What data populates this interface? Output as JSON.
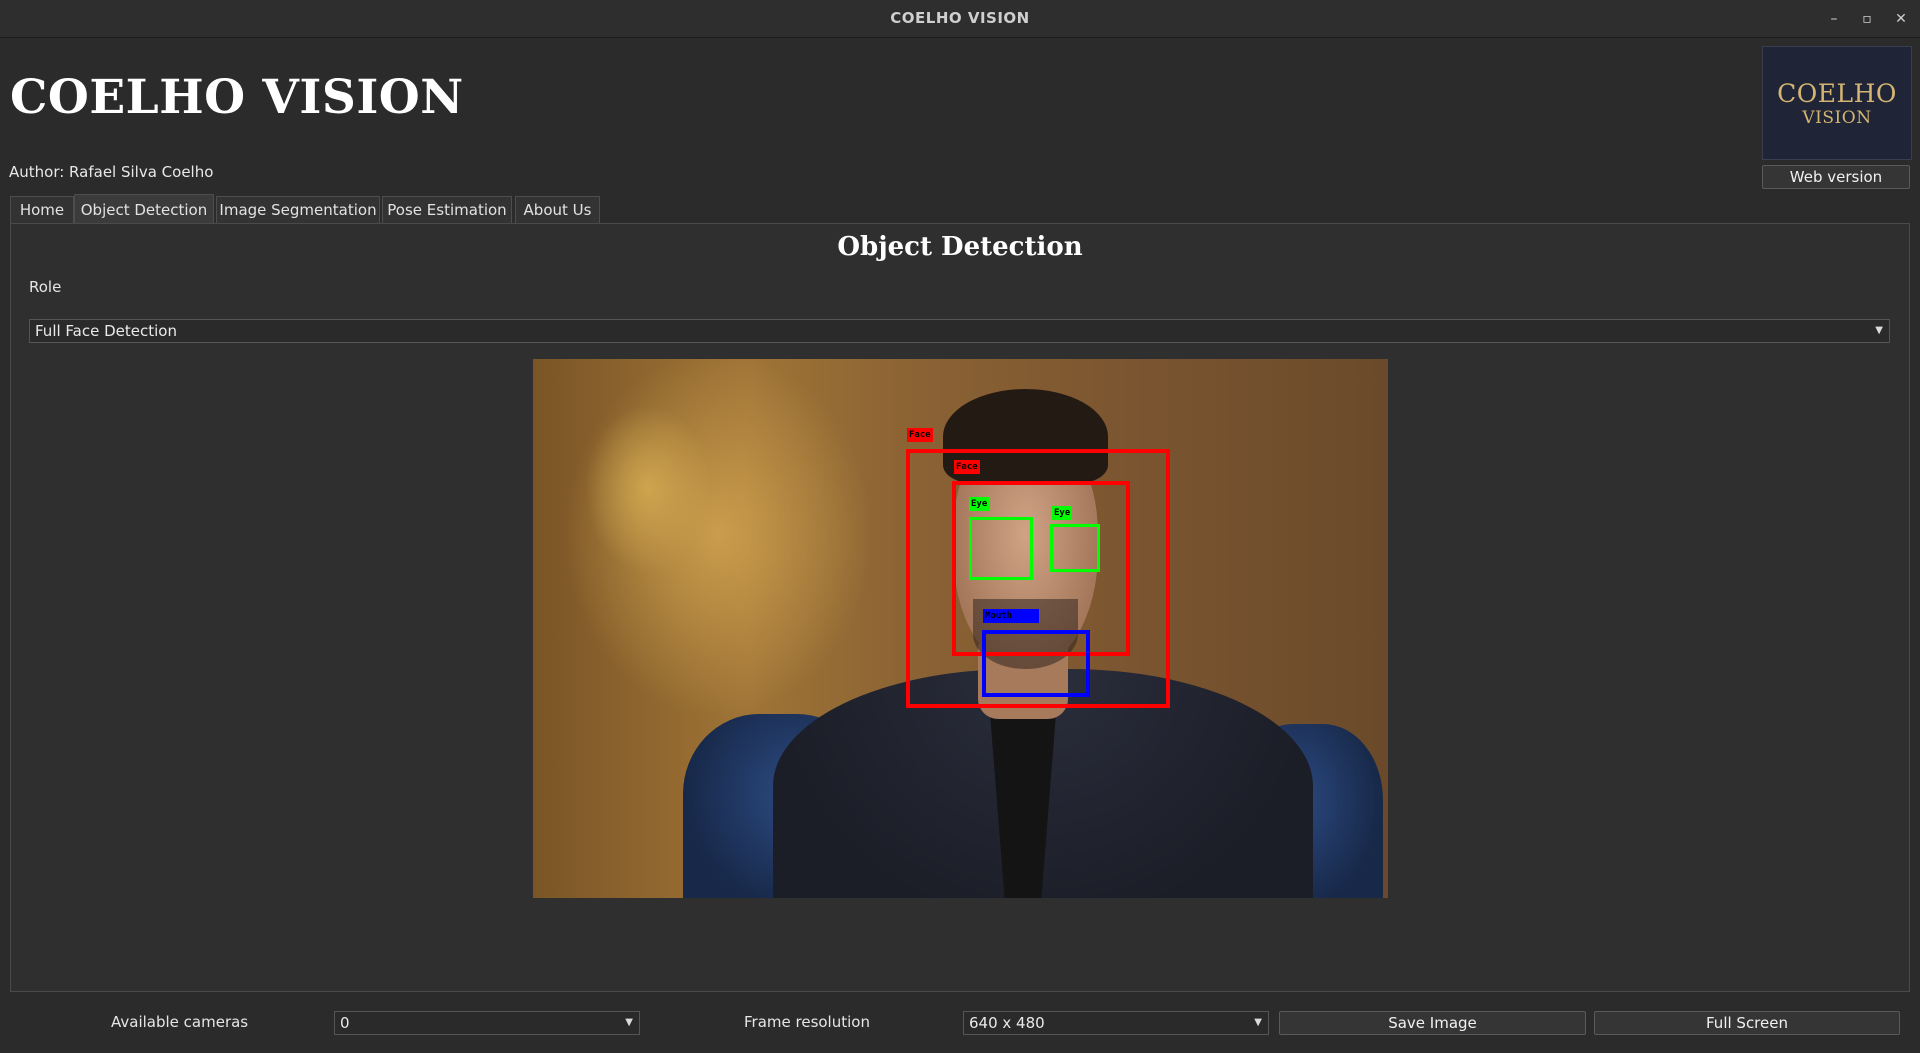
{
  "window": {
    "title": "COELHO VISION",
    "controls": {
      "minimize": "–",
      "maximize": "▫",
      "close": "✕"
    }
  },
  "header": {
    "app_title": "COELHO VISION",
    "author": "Author: Rafael Silva Coelho",
    "logo": {
      "line1": "COELHO",
      "line2": "VISION"
    },
    "web_version_label": "Web version"
  },
  "tabs": [
    {
      "label": "Home",
      "active": false
    },
    {
      "label": "Object Detection",
      "active": true
    },
    {
      "label": "Image Segmentation",
      "active": false
    },
    {
      "label": "Pose Estimation",
      "active": false
    },
    {
      "label": "About Us",
      "active": false
    }
  ],
  "panel": {
    "title": "Object Detection",
    "role_label": "Role",
    "role_selected": "Full Face Detection"
  },
  "detections": [
    {
      "label": "Face",
      "color": "#ff0000"
    },
    {
      "label": "Face",
      "color": "#ff0000"
    },
    {
      "label": "Eye",
      "color": "#00ff00"
    },
    {
      "label": "Eye",
      "color": "#00ff00"
    },
    {
      "label": "Mouth",
      "color": "#0000ff"
    }
  ],
  "footer": {
    "cameras_label": "Available cameras",
    "camera_selected": "0",
    "resolution_label": "Frame resolution",
    "resolution_selected": "640 x 480",
    "save_label": "Save Image",
    "fullscreen_label": "Full Screen"
  },
  "colors": {
    "background": "#2b2b2b",
    "logo_bg": "#1f2537",
    "logo_text": "#d4b572"
  }
}
